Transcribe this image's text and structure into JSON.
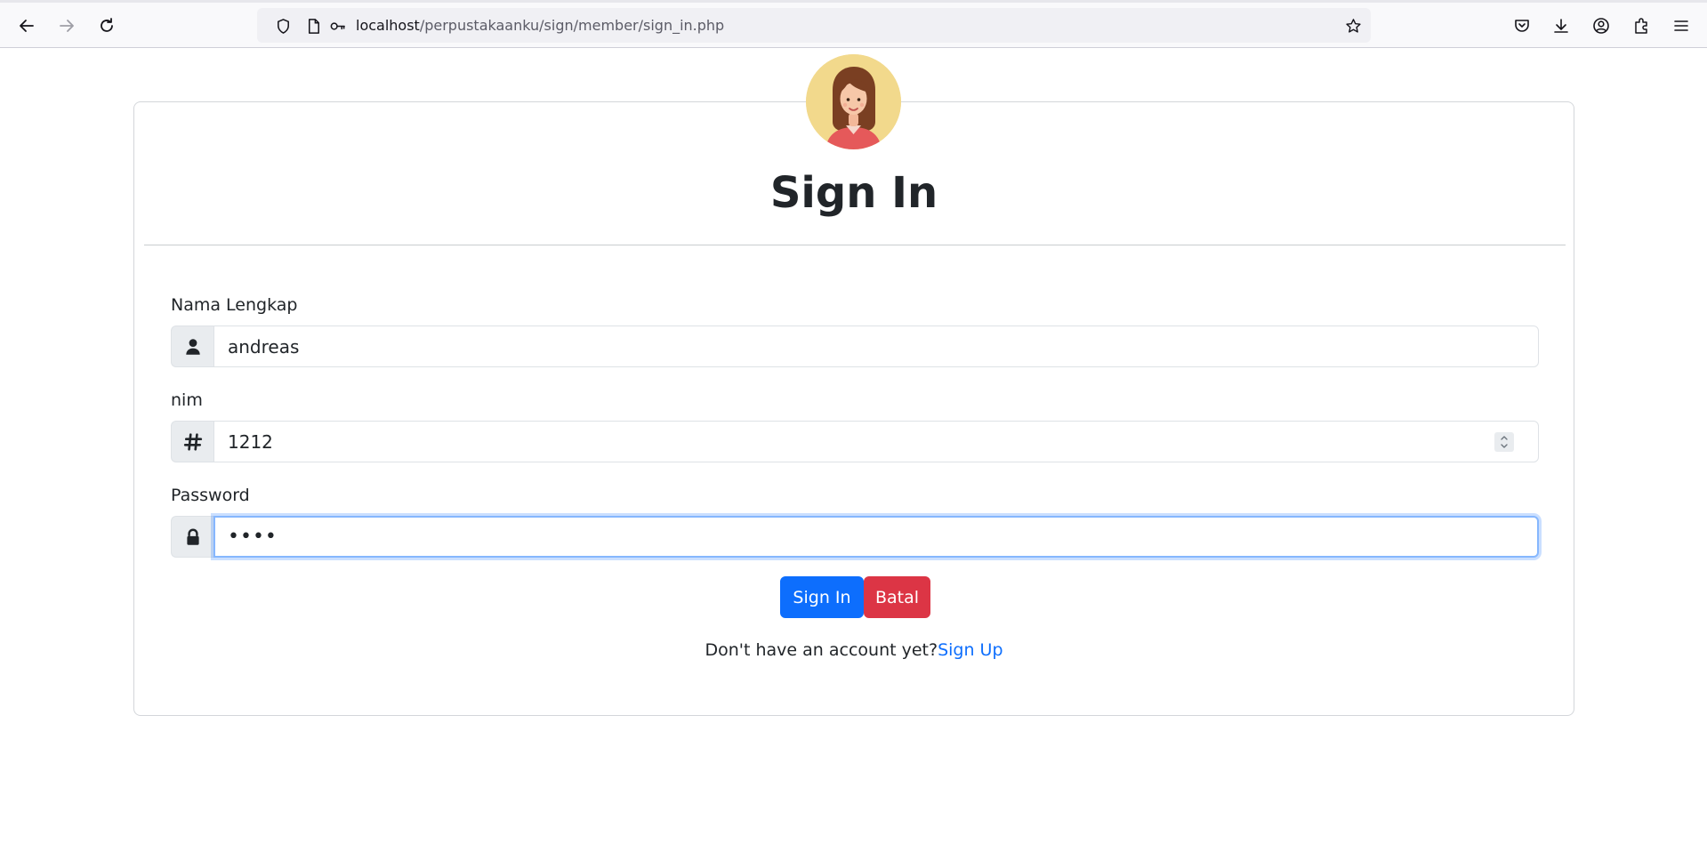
{
  "browser": {
    "url_host": "localhost",
    "url_path": "/perpustakaanku/sign/member/sign_in.php",
    "icons": [
      "back-arrow-icon",
      "forward-arrow-icon",
      "reload-icon",
      "shield-icon",
      "page-icon",
      "key-icon",
      "star-icon",
      "pocket-icon",
      "download-icon",
      "account-icon",
      "extensions-icon",
      "menu-icon"
    ]
  },
  "form": {
    "title": "Sign In",
    "name_label": "Nama Lengkap",
    "name_value": "andreas",
    "nim_label": "nim",
    "nim_value": "1212",
    "password_label": "Password",
    "password_value": "••••",
    "sign_in_button": "Sign In",
    "cancel_button": "Batal",
    "no_account_text": "Don't have an account yet?",
    "sign_up_link": "Sign Up"
  },
  "colors": {
    "primary": "#0d6efd",
    "danger": "#dc3545",
    "focus_ring": "#86b7fe",
    "avatar_bg": "#f2d98c"
  }
}
